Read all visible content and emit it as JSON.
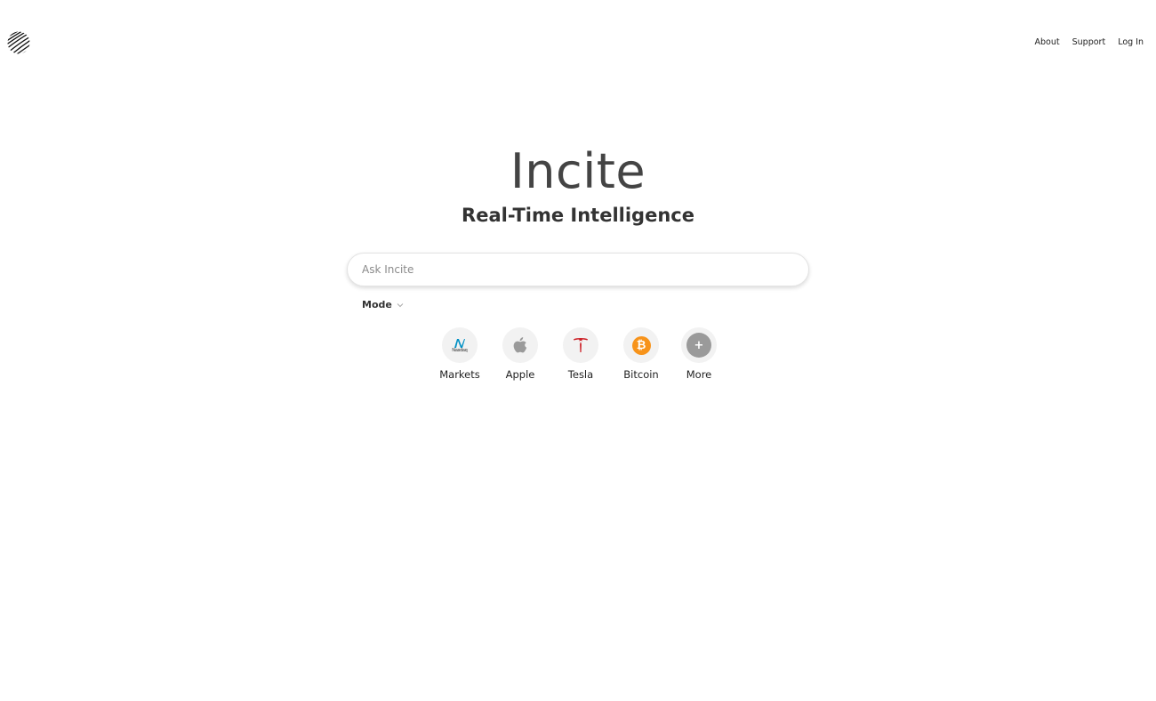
{
  "header": {
    "logo_icon": "fingerprint-icon",
    "nav": [
      {
        "label": "About"
      },
      {
        "label": "Support"
      },
      {
        "label": "Log In"
      }
    ]
  },
  "hero": {
    "title": "Incite",
    "subtitle": "Real-Time Intelligence"
  },
  "search": {
    "value": "",
    "placeholder": "Ask Incite"
  },
  "mode": {
    "label": "Mode",
    "icon": "chevron-down-icon"
  },
  "quick_links": [
    {
      "label": "Markets",
      "icon": "nasdaq-icon",
      "logo_text": "Nasdaq",
      "color": "#0090c4"
    },
    {
      "label": "Apple",
      "icon": "apple-icon",
      "color": "#9a9a9a"
    },
    {
      "label": "Tesla",
      "icon": "tesla-icon",
      "color": "#cc1f26"
    },
    {
      "label": "Bitcoin",
      "icon": "bitcoin-icon",
      "symbol": "₿",
      "color": "#f7931a"
    },
    {
      "label": "More",
      "icon": "plus-icon",
      "symbol": "+",
      "color": "#9a9a9a"
    }
  ]
}
